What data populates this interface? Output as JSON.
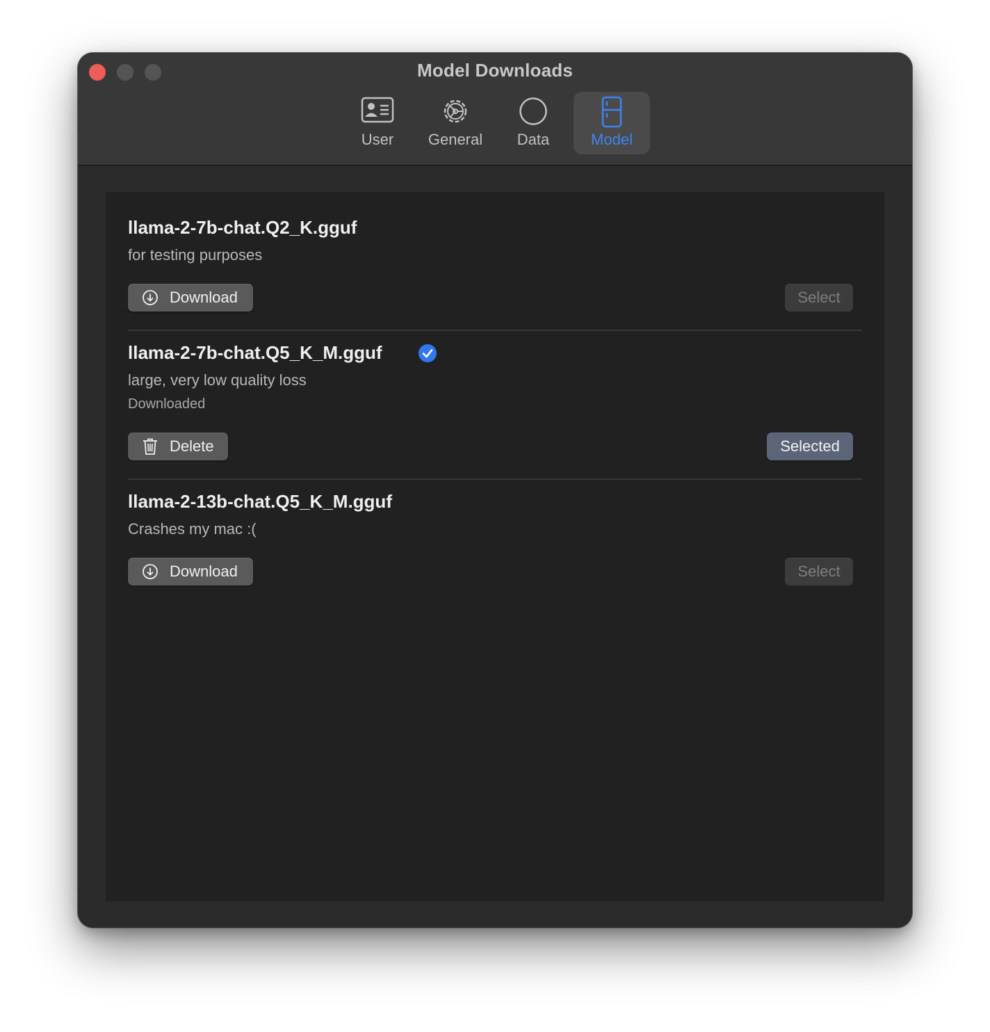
{
  "window": {
    "title": "Model Downloads"
  },
  "tabs": [
    {
      "label": "User",
      "icon": "user-card-icon",
      "active": false
    },
    {
      "label": "General",
      "icon": "gear-icon",
      "active": false
    },
    {
      "label": "Data",
      "icon": "circle-icon",
      "active": false
    },
    {
      "label": "Model",
      "icon": "model-device-icon",
      "active": true
    }
  ],
  "colors": {
    "accent": "#3f84f0",
    "close": "#ec5e57",
    "window_bg": "#2b2b2b",
    "content_bg": "#222121"
  },
  "models": [
    {
      "name": "llama-2-7b-chat.Q2_K.gguf",
      "description": "for testing purposes",
      "status": "",
      "downloaded": false,
      "action_label": "Download",
      "action_icon": "download-icon",
      "select_label": "Select",
      "select_state": "disabled"
    },
    {
      "name": "llama-2-7b-chat.Q5_K_M.gguf",
      "description": "large, very low quality loss",
      "status": "Downloaded",
      "downloaded": true,
      "action_label": "Delete",
      "action_icon": "trash-icon",
      "select_label": "Selected",
      "select_state": "selected"
    },
    {
      "name": "llama-2-13b-chat.Q5_K_M.gguf",
      "description": "Crashes my mac :(",
      "status": "",
      "downloaded": false,
      "action_label": "Download",
      "action_icon": "download-icon",
      "select_label": "Select",
      "select_state": "disabled"
    }
  ]
}
